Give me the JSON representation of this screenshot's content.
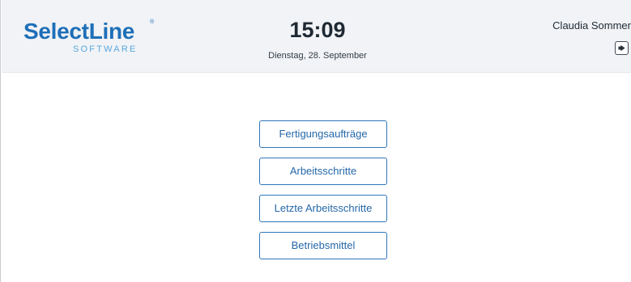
{
  "brand": {
    "name": "SelectLine",
    "registered_mark": "®",
    "subtitle": "SOFTWARE",
    "color": "#1e6fb8",
    "subtitle_color": "#58a6df"
  },
  "clock": {
    "time": "15:09",
    "date": "Dienstag, 28. September"
  },
  "user": {
    "name": "Claudia Sommer",
    "logout_icon": "logout-icon"
  },
  "menu": {
    "items": [
      {
        "label": "Fertigungsaufträge"
      },
      {
        "label": "Arbeitsschritte"
      },
      {
        "label": "Letzte Arbeitsschritte"
      },
      {
        "label": "Betriebsmittel"
      }
    ],
    "accent": "#2f76b8"
  }
}
